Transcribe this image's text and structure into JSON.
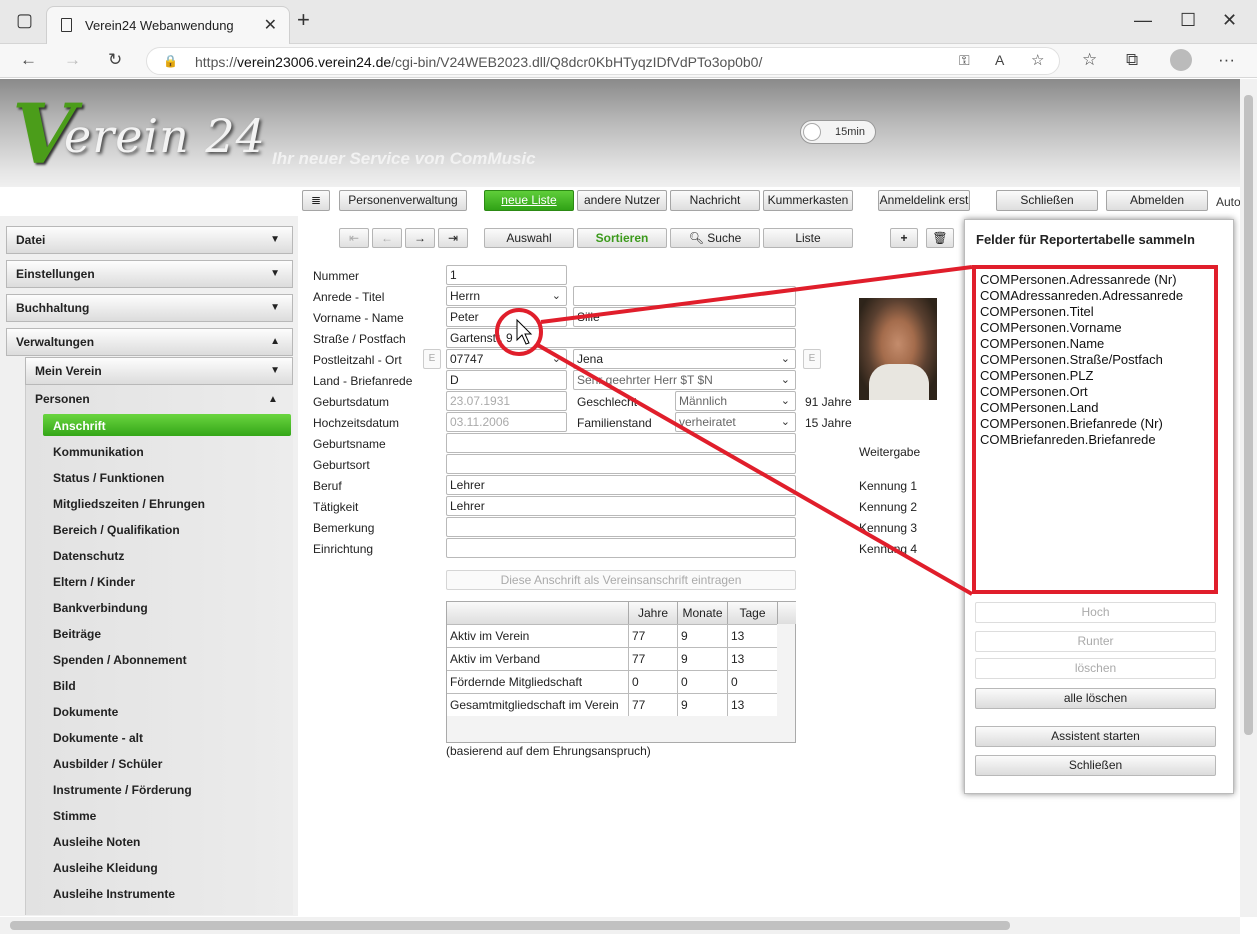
{
  "browser": {
    "tab_title": "Verein24 Webanwendung",
    "url_prefix": "https://",
    "url_host": "verein23006.verein24.de",
    "url_path": "/cgi-bin/V24WEB2023.dll/Q8dcr0KbHTyqzIDfVdPTo3op0b0/"
  },
  "header": {
    "logo_v": "V",
    "logo_rest": "erein 24",
    "slogan": "Ihr neuer Service von ComMusic",
    "timer": "15min"
  },
  "toolbar": {
    "menu_icon": "≣",
    "buttons": [
      "Personenverwaltung",
      "neue Liste",
      "andere Nutzer",
      "Nachricht",
      "Kummerkasten",
      "Anmeldelink erst",
      "Schließen",
      "Abmelden"
    ],
    "auto_text": "Auto"
  },
  "nav": {
    "datei": "Datei",
    "einstellungen": "Einstellungen",
    "buchhaltung": "Buchhaltung",
    "verwaltungen": "Verwaltungen",
    "mein_verein": "Mein Verein",
    "personen": "Personen",
    "items": [
      "Anschrift",
      "Kommunikation",
      "Status / Funktionen",
      "Mitgliedszeiten / Ehrungen",
      "Bereich / Qualifikation",
      "Datenschutz",
      "Eltern / Kinder",
      "Bankverbindung",
      "Beiträge",
      "Spenden / Abonnement",
      "Bild",
      "Dokumente",
      "Dokumente - alt",
      "Ausbilder / Schüler",
      "Instrumente / Förderung",
      "Stimme",
      "Ausleihe Noten",
      "Ausleihe Kleidung",
      "Ausleihe Instrumente"
    ]
  },
  "actions": {
    "first": "⇤",
    "prev": "←",
    "next": "→",
    "last": "⇥",
    "auswahl": "Auswahl",
    "sortieren": "Sortieren",
    "suche": "Suche",
    "liste": "Liste",
    "add": "+",
    "delete": "🗑"
  },
  "form": {
    "labels": {
      "nummer": "Nummer",
      "anrede": "Anrede - Titel",
      "name": "Vorname - Name",
      "strasse": "Straße / Postfach",
      "plz": "Postleitzahl - Ort",
      "land": "Land - Briefanrede",
      "geburt": "Geburtsdatum",
      "hochzeit": "Hochzeitsdatum",
      "geburtsname": "Geburtsname",
      "geburtsort": "Geburtsort",
      "beruf": "Beruf",
      "taetigkeit": "Tätigkeit",
      "bemerkung": "Bemerkung",
      "einrichtung": "Einrichtung",
      "geschlecht": "Geschlecht",
      "familienstand": "Familienstand"
    },
    "values": {
      "nummer": "1",
      "anrede": "Herrn",
      "vorname": "Peter",
      "nachname": "Silie",
      "strasse": "Gartenstr. 9",
      "plz": "07747",
      "ort": "Jena",
      "land": "D",
      "briefanrede": "Sehr geehrter Herr $T $N",
      "geburtsdatum": "23.07.1931",
      "hochzeitsdatum": "03.11.2006",
      "geschlecht": "Männlich",
      "familienstand": "verheiratet",
      "beruf": "Lehrer",
      "taetigkeit": "Lehrer"
    },
    "e_label": "E",
    "age": "91 Jahre",
    "married_years": "15 Jahre",
    "weitergabe": "Weitergabe",
    "kennung": [
      "Kennung 1",
      "Kennung 2",
      "Kennung 3",
      "Kennung 4"
    ],
    "vereinsanschrift_btn": "Diese Anschrift als Vereinsanschrift eintragen"
  },
  "membership_table": {
    "headers": [
      "",
      "Jahre",
      "Monate",
      "Tage"
    ],
    "rows": [
      [
        "Aktiv im Verein",
        "77",
        "9",
        "13"
      ],
      [
        "Aktiv im Verband",
        "77",
        "9",
        "13"
      ],
      [
        "Fördernde Mitgliedschaft",
        "0",
        "0",
        "0"
      ],
      [
        "Gesamtmitgliedschaft im Verein",
        "77",
        "9",
        "13"
      ]
    ],
    "note": "(basierend auf dem Ehrungsanspruch)"
  },
  "dialog": {
    "title": "Felder für Reportertabelle sammeln",
    "fields": [
      "COMPersonen.Adressanrede (Nr)",
      "COMAdressanreden.Adressanrede",
      "COMPersonen.Titel",
      "COMPersonen.Vorname",
      "COMPersonen.Name",
      "COMPersonen.Straße/Postfach",
      "COMPersonen.PLZ",
      "COMPersonen.Ort",
      "COMPersonen.Land",
      "COMPersonen.Briefanrede (Nr)",
      "COMBriefanreden.Briefanrede"
    ],
    "hoch": "Hoch",
    "runter": "Runter",
    "loeschen": "löschen",
    "alle_loeschen": "alle löschen",
    "assistent": "Assistent starten",
    "schliessen": "Schließen"
  },
  "colors": {
    "accent_green": "#34a618",
    "annotation_red": "#e01e2b"
  }
}
